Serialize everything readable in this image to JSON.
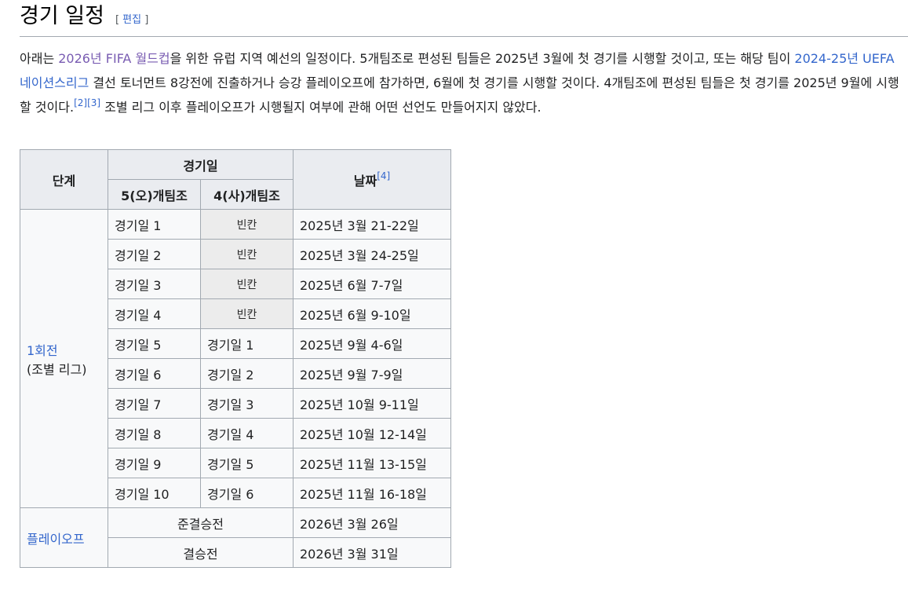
{
  "heading": {
    "title": "경기 일정",
    "edit_open": "[ ",
    "edit_label": "편집",
    "edit_close": " ]"
  },
  "intro": {
    "t1": "아래는 ",
    "link_wc": "2026년 FIFA 월드컵",
    "t2": "을 위한 유럽 지역 예선의 일정이다. 5개팀조로 편성된 팀들은 2025년 3월에 첫 경기를 시행할 것이고, 또는 해당 팀이 ",
    "link_nl": "2024-25년 UEFA 네이션스리그",
    "t3": " 결선 토너먼트 8강전에 진출하거나 승강 플레이오프에 참가하면, 6월에 첫 경기를 시행할 것이다. 4개팀조에 편성된 팀들은 첫 경기를 2025년 9월에 시행할 것이다.",
    "ref2": "[2]",
    "ref3": "[3]",
    "t4": " 조별 리그 이후 플레이오프가 시행될지 여부에 관해 어떤 선언도 만들어지지 않았다."
  },
  "table": {
    "headers": {
      "stage": "단계",
      "matchday": "경기일",
      "five_team": "5(오)개팀조",
      "four_team": "4(사)개팀조",
      "date": "날짜",
      "date_ref": "[4]"
    },
    "first_round": {
      "link": "1회전",
      "sub": "(조별 리그)"
    },
    "rows": [
      {
        "five": "경기일 1",
        "four": "빈칸",
        "date": "2025년 3월 21-22일"
      },
      {
        "five": "경기일 2",
        "four": "빈칸",
        "date": "2025년 3월 24-25일"
      },
      {
        "five": "경기일 3",
        "four": "빈칸",
        "date": "2025년 6월 7-7일"
      },
      {
        "five": "경기일 4",
        "four": "빈칸",
        "date": "2025년 6월 9-10일"
      },
      {
        "five": "경기일 5",
        "four": "경기일 1",
        "date": "2025년 9월 4-6일"
      },
      {
        "five": "경기일 6",
        "four": "경기일 2",
        "date": "2025년 9월 7-9일"
      },
      {
        "five": "경기일 7",
        "four": "경기일 3",
        "date": "2025년 10월 9-11일"
      },
      {
        "five": "경기일 8",
        "four": "경기일 4",
        "date": "2025년 10월 12-14일"
      },
      {
        "five": "경기일 9",
        "four": "경기일 5",
        "date": "2025년 11월 13-15일"
      },
      {
        "five": "경기일 10",
        "four": "경기일 6",
        "date": "2025년 11월 16-18일"
      }
    ],
    "playoff": {
      "link": "플레이오프"
    },
    "playoff_rows": [
      {
        "round": "준결승전",
        "date": "2026년 3월 26일"
      },
      {
        "round": "결승전",
        "date": "2026년 3월 31일"
      }
    ]
  },
  "colors": {
    "link": "#3366cc",
    "visited_link": "#795cb2",
    "border": "#a2a9b1",
    "header_bg": "#eaecf0",
    "empty_cell_bg": "#ececec"
  }
}
